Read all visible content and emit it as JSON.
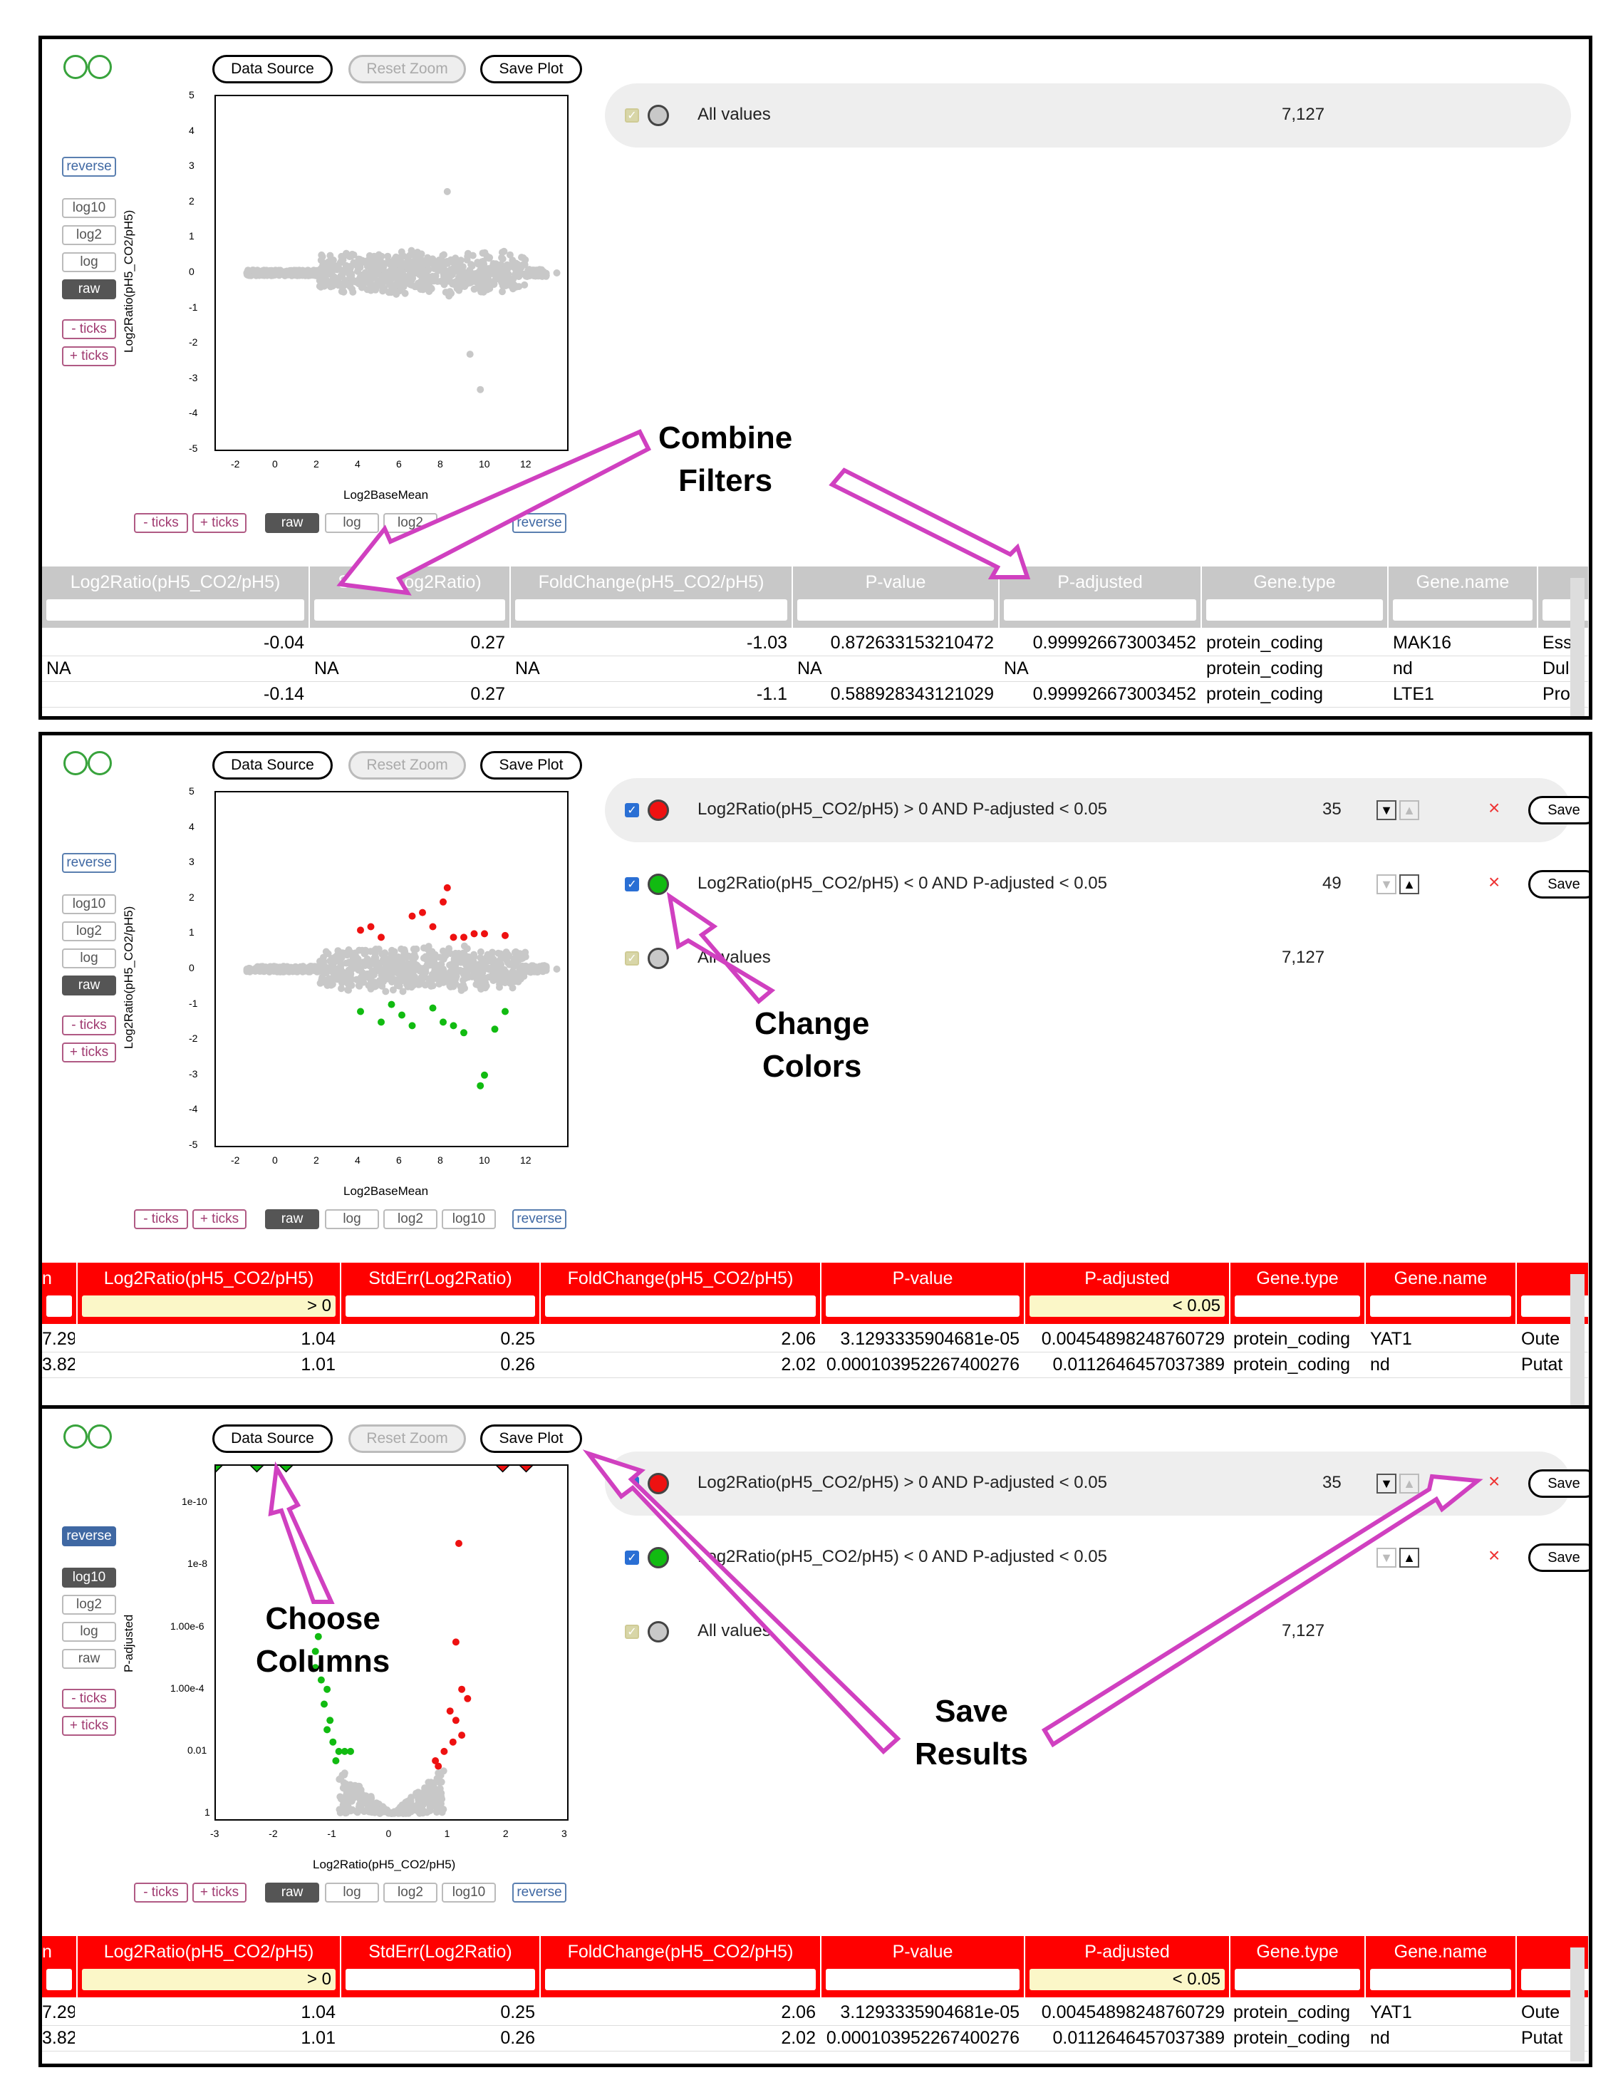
{
  "toolbar": {
    "data_source": "Data Source",
    "reset_zoom": "Reset Zoom",
    "save_plot": "Save Plot"
  },
  "side_buttons": {
    "reverse": "reverse",
    "log10": "log10",
    "log2": "log2",
    "log": "log",
    "raw": "raw",
    "minus_ticks": "- ticks",
    "plus_ticks": "+ ticks"
  },
  "bottom_buttons": {
    "minus_ticks": "- ticks",
    "plus_ticks": "+ ticks",
    "raw": "raw",
    "log": "log",
    "log2": "log2",
    "log10": "log10",
    "reverse": "reverse"
  },
  "panel1": {
    "plot": {
      "ylabel": "Log2Ratio(pH5_CO2/pH5)",
      "xlabel": "Log2BaseMean"
    },
    "filters": [
      {
        "label": "All values",
        "count": "7,127"
      }
    ],
    "table": {
      "columns": [
        "Log2Ratio(pH5_CO2/pH5)",
        "StdErr(Log2Ratio)",
        "FoldChange(pH5_CO2/pH5)",
        "P-value",
        "P-adjusted",
        "Gene.type",
        "Gene.name"
      ],
      "rows": [
        [
          "-0.04",
          "0.27",
          "-1.03",
          "0.872633153210472",
          "0.999926673003452",
          "protein_coding",
          "MAK16",
          "Ess"
        ],
        [
          "NA",
          "NA",
          "NA",
          "NA",
          "NA",
          "protein_coding",
          "nd",
          "Dul"
        ],
        [
          "-0.14",
          "0.27",
          "-1.1",
          "0.588928343121029",
          "0.999926673003452",
          "protein_coding",
          "LTE1",
          "Pro"
        ]
      ]
    }
  },
  "panel2": {
    "plot": {
      "ylabel": "Log2Ratio(pH5_CO2/pH5)",
      "xlabel": "Log2BaseMean"
    },
    "filters": [
      {
        "label": "Log2Ratio(pH5_CO2/pH5) > 0 AND P-adjusted < 0.05",
        "count": "35",
        "save": "Save"
      },
      {
        "label": "Log2Ratio(pH5_CO2/pH5) < 0 AND P-adjusted < 0.05",
        "count": "49",
        "save": "Save"
      },
      {
        "label": "All values",
        "count": "7,127"
      }
    ],
    "table": {
      "first_col_fragment": "n",
      "columns": [
        "Log2Ratio(pH5_CO2/pH5)",
        "StdErr(Log2Ratio)",
        "FoldChange(pH5_CO2/pH5)",
        "P-value",
        "P-adjusted",
        "Gene.type",
        "Gene.name"
      ],
      "inputs": [
        "> 0",
        "",
        "",
        "",
        "< 0.05",
        "",
        ""
      ],
      "rows": [
        [
          "7.29",
          "1.04",
          "0.25",
          "2.06",
          "3.1293335904681e-05",
          "0.00454898248760729",
          "protein_coding",
          "YAT1",
          "Oute"
        ],
        [
          "3.82",
          "1.01",
          "0.26",
          "2.02",
          "0.000103952267400276",
          "0.0112646457037389",
          "protein_coding",
          "nd",
          "Putat"
        ]
      ]
    }
  },
  "panel3": {
    "plot": {
      "ylabel": "P-adjusted",
      "xlabel": "Log2Ratio(pH5_CO2/pH5)"
    },
    "filters": [
      {
        "label": "Log2Ratio(pH5_CO2/pH5) > 0 AND P-adjusted < 0.05",
        "count": "35",
        "save": "Save"
      },
      {
        "label": "Log2Ratio(pH5_CO2/pH5) < 0 AND P-adjusted < 0.05",
        "count": "49",
        "save": "Save"
      },
      {
        "label": "All values",
        "count": "7,127"
      }
    ],
    "table": {
      "first_col_fragment": "n",
      "columns": [
        "Log2Ratio(pH5_CO2/pH5)",
        "StdErr(Log2Ratio)",
        "FoldChange(pH5_CO2/pH5)",
        "P-value",
        "P-adjusted",
        "Gene.type",
        "Gene.name"
      ],
      "inputs": [
        "> 0",
        "",
        "",
        "",
        "< 0.05",
        "",
        ""
      ],
      "rows": [
        [
          "7.29",
          "1.04",
          "0.25",
          "2.06",
          "3.1293335904681e-05",
          "0.00454898248760729",
          "protein_coding",
          "YAT1",
          "Oute"
        ],
        [
          "3.82",
          "1.01",
          "0.26",
          "2.02",
          "0.000103952267400276",
          "0.0112646457037389",
          "protein_coding",
          "nd",
          "Putat"
        ]
      ]
    }
  },
  "callouts": {
    "combine": [
      "Combine",
      "Filters"
    ],
    "change": [
      "Change",
      "Colors"
    ],
    "choose": [
      "Choose",
      "Columns"
    ],
    "save": [
      "Save",
      "Results"
    ]
  },
  "colors": {
    "up": "#ee1111",
    "down": "#11bb11",
    "all": "#c8c8c8",
    "arrow": "#d040c0"
  },
  "chart_data": [
    {
      "type": "scatter",
      "xlabel": "Log2BaseMean",
      "ylabel": "Log2Ratio(pH5_CO2/pH5)",
      "xlim": [
        -3,
        14
      ],
      "ylim": [
        -5,
        5
      ],
      "xticks": [
        -2,
        0,
        2,
        4,
        6,
        8,
        10,
        12
      ],
      "yticks": [
        5,
        4,
        3,
        2,
        1,
        0,
        -1,
        -2,
        -3,
        -4,
        -5
      ],
      "series": [
        {
          "name": "All values",
          "color": "#c8c8c8",
          "points": [
            [
              -1.5,
              0
            ],
            [
              0,
              0.05
            ],
            [
              2,
              0
            ],
            [
              3,
              0.1
            ],
            [
              4,
              -0.1
            ],
            [
              5,
              0.2
            ],
            [
              6,
              -0.2
            ],
            [
              7,
              0.1
            ],
            [
              8,
              0.3
            ],
            [
              9,
              -0.3
            ],
            [
              10,
              0.1
            ],
            [
              11,
              0
            ],
            [
              13.5,
              0
            ],
            [
              8.2,
              2.3
            ],
            [
              9.8,
              -3.3
            ],
            [
              9.3,
              -2.3
            ]
          ]
        }
      ]
    },
    {
      "type": "scatter",
      "xlabel": "Log2BaseMean",
      "ylabel": "Log2Ratio(pH5_CO2/pH5)",
      "xlim": [
        -3,
        14
      ],
      "ylim": [
        -5,
        5
      ],
      "xticks": [
        -2,
        0,
        2,
        4,
        6,
        8,
        10,
        12
      ],
      "yticks": [
        5,
        4,
        3,
        2,
        1,
        0,
        -1,
        -2,
        -3,
        -4,
        -5
      ],
      "series": [
        {
          "name": "Log2Ratio(pH5_CO2/pH5) > 0 AND P-adjusted < 0.05",
          "color": "#ee1111",
          "points": [
            [
              4,
              1.1
            ],
            [
              4.5,
              1.2
            ],
            [
              5,
              0.9
            ],
            [
              6.5,
              1.5
            ],
            [
              7,
              1.6
            ],
            [
              7.5,
              1.2
            ],
            [
              8.2,
              2.3
            ],
            [
              8,
              1.9
            ],
            [
              8.5,
              0.9
            ],
            [
              9,
              0.9
            ],
            [
              9.5,
              1.0
            ],
            [
              10,
              1.0
            ],
            [
              11,
              0.95
            ]
          ]
        },
        {
          "name": "Log2Ratio(pH5_CO2/pH5) < 0 AND P-adjusted < 0.05",
          "color": "#11bb11",
          "points": [
            [
              4,
              -1.2
            ],
            [
              5,
              -1.5
            ],
            [
              5.5,
              -1.0
            ],
            [
              6,
              -1.3
            ],
            [
              6.5,
              -1.6
            ],
            [
              7.5,
              -1.1
            ],
            [
              8,
              -1.5
            ],
            [
              8.5,
              -1.6
            ],
            [
              9,
              -1.8
            ],
            [
              9.8,
              -3.3
            ],
            [
              10,
              -3.0
            ],
            [
              10.5,
              -1.7
            ],
            [
              11,
              -1.2
            ]
          ]
        },
        {
          "name": "All values",
          "color": "#c8c8c8",
          "points": [
            [
              -1.5,
              0
            ],
            [
              0,
              0.05
            ],
            [
              2,
              0
            ],
            [
              4,
              0
            ],
            [
              6,
              0
            ],
            [
              8,
              0
            ],
            [
              10,
              0
            ],
            [
              12,
              0
            ],
            [
              13.5,
              0
            ]
          ]
        }
      ]
    },
    {
      "type": "scatter",
      "xlabel": "Log2Ratio(pH5_CO2/pH5)",
      "ylabel": "P-adjusted",
      "yscale": "log-reversed",
      "xlim": [
        -3,
        3
      ],
      "xticks": [
        -3,
        -2,
        -1,
        0,
        1,
        2,
        3
      ],
      "yticks": [
        "1e-10",
        "1e-8",
        "1.00e-6",
        "1.00e-4",
        "0.01",
        "1"
      ],
      "series": [
        {
          "name": "Log2Ratio(pH5_CO2/pH5) > 0 AND P-adjusted < 0.05",
          "color": "#ee1111",
          "points": [
            [
              1.15,
              2e-09
            ],
            [
              1.1,
              3e-06
            ],
            [
              1.2,
              0.0001
            ],
            [
              1.3,
              0.0002
            ],
            [
              1.0,
              0.0005
            ],
            [
              1.1,
              0.001
            ],
            [
              0.9,
              0.01
            ],
            [
              0.75,
              0.02
            ],
            [
              0.8,
              0.03
            ],
            [
              1.05,
              0.005
            ],
            [
              1.2,
              0.003
            ]
          ]
        },
        {
          "name": "Log2Ratio(pH5_CO2/pH5) < 0 AND P-adjusted < 0.05",
          "color": "#11bb11",
          "points": [
            [
              -1.25,
              2e-06
            ],
            [
              -1.3,
              6e-06
            ],
            [
              -1.3,
              2e-05
            ],
            [
              -1.2,
              5e-05
            ],
            [
              -1.1,
              0.0001
            ],
            [
              -1.15,
              0.0003
            ],
            [
              -1.05,
              0.001
            ],
            [
              -1.1,
              0.002
            ],
            [
              -1.0,
              0.005
            ],
            [
              -0.9,
              0.01
            ],
            [
              -0.8,
              0.01
            ],
            [
              -0.95,
              0.02
            ],
            [
              -0.7,
              0.01
            ]
          ]
        },
        {
          "name": "All values",
          "color": "#c8c8c8",
          "points": [
            [
              -0.8,
              0.05
            ],
            [
              -0.6,
              0.2
            ],
            [
              -0.4,
              0.6
            ],
            [
              -0.2,
              1
            ],
            [
              0,
              1
            ],
            [
              0.2,
              1
            ],
            [
              0.4,
              0.6
            ],
            [
              0.6,
              0.2
            ],
            [
              0.8,
              0.05
            ]
          ]
        }
      ]
    }
  ]
}
